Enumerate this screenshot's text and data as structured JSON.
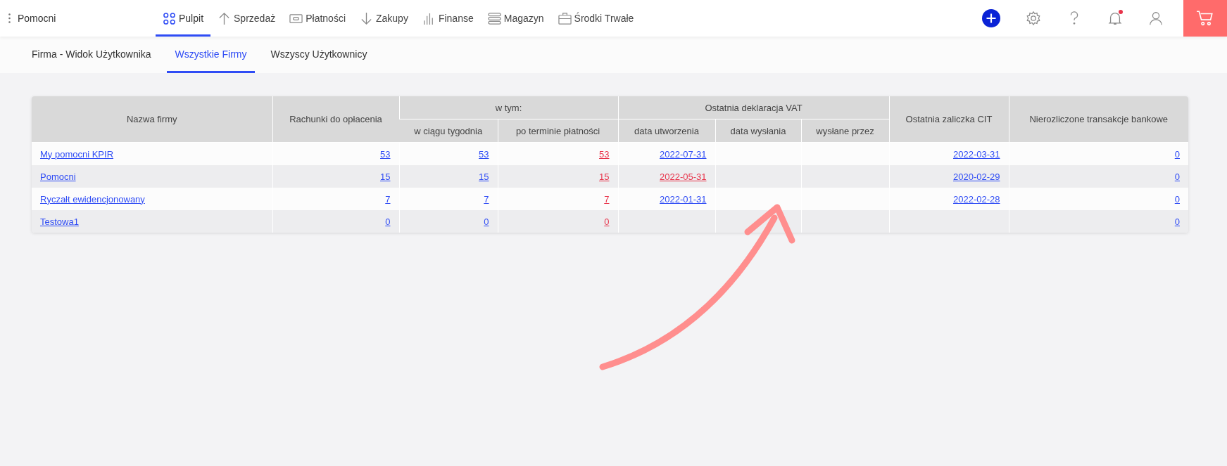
{
  "topbar": {
    "company": "Pomocni",
    "nav": [
      {
        "label": "Pulpit",
        "selected": true
      },
      {
        "label": "Sprzedaż",
        "selected": false
      },
      {
        "label": "Płatności",
        "selected": false
      },
      {
        "label": "Zakupy",
        "selected": false
      },
      {
        "label": "Finanse",
        "selected": false
      },
      {
        "label": "Magazyn",
        "selected": false
      },
      {
        "label": "Środki Trwałe",
        "selected": false
      }
    ],
    "notifications_unread": true
  },
  "subtabs": [
    {
      "label": "Firma - Widok Użytkownika",
      "selected": false
    },
    {
      "label": "Wszystkie Firmy",
      "selected": true
    },
    {
      "label": "Wszyscy Użytkownicy",
      "selected": false
    }
  ],
  "table": {
    "columns": [
      "Nazwa firmy",
      "Rachunki do opłacenia",
      "w ciągu tygodnia",
      "po terminie płatności",
      "data utworzenia",
      "data wysłania",
      "wysłane przez",
      "Ostatnia zaliczka CIT",
      "Nierozliczone transakcje bankowe"
    ],
    "groups": [
      "w tym:",
      "Ostatnia deklaracja VAT"
    ],
    "rows": [
      {
        "cells": [
          {
            "text": "My pomocni KPIR",
            "overdue": false
          },
          {
            "text": "53",
            "overdue": false
          },
          {
            "text": "53",
            "overdue": false
          },
          {
            "text": "53",
            "overdue": true
          },
          {
            "text": "2022-07-31",
            "overdue": false
          },
          null,
          null,
          {
            "text": "2022-03-31",
            "overdue": false
          },
          {
            "text": "0",
            "overdue": false
          }
        ]
      },
      {
        "cells": [
          {
            "text": "Pomocni",
            "overdue": false
          },
          {
            "text": "15",
            "overdue": false
          },
          {
            "text": "15",
            "overdue": false
          },
          {
            "text": "15",
            "overdue": true
          },
          {
            "text": "2022-05-31",
            "overdue": true
          },
          null,
          null,
          {
            "text": "2020-02-29",
            "overdue": false
          },
          {
            "text": "0",
            "overdue": false
          }
        ]
      },
      {
        "cells": [
          {
            "text": "Ryczałt ewidencjonowany",
            "overdue": false
          },
          {
            "text": "7",
            "overdue": false
          },
          {
            "text": "7",
            "overdue": false
          },
          {
            "text": "7",
            "overdue": true
          },
          {
            "text": "2022-01-31",
            "overdue": false
          },
          null,
          null,
          {
            "text": "2022-02-28",
            "overdue": false
          },
          {
            "text": "0",
            "overdue": false
          }
        ]
      },
      {
        "cells": [
          {
            "text": "Testowa1",
            "overdue": false
          },
          {
            "text": "0",
            "overdue": false
          },
          {
            "text": "0",
            "overdue": false
          },
          {
            "text": "0",
            "overdue": true
          },
          null,
          null,
          null,
          null,
          {
            "text": "0",
            "overdue": false
          }
        ]
      }
    ]
  }
}
